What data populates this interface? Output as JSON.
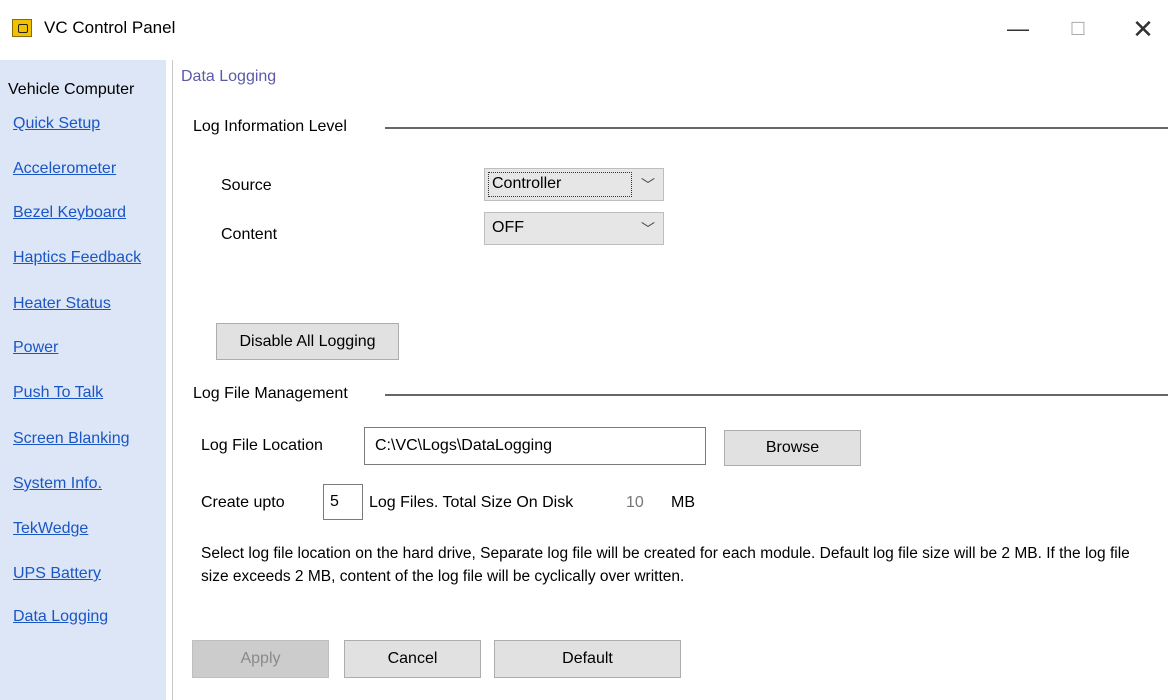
{
  "window": {
    "title": "VC Control Panel",
    "controls": {
      "minimize": "—",
      "maximize": "☐",
      "close": "✕"
    }
  },
  "sidebar": {
    "title": "Vehicle Computer",
    "items": [
      {
        "label": "Quick Setup"
      },
      {
        "label": "Accelerometer"
      },
      {
        "label": "Bezel Keyboard"
      },
      {
        "label": "Haptics Feedback"
      },
      {
        "label": "Heater Status"
      },
      {
        "label": "Power"
      },
      {
        "label": "Push To Talk"
      },
      {
        "label": "Screen Blanking"
      },
      {
        "label": "System Info."
      },
      {
        "label": "TekWedge"
      },
      {
        "label": "UPS Battery"
      },
      {
        "label": "Data Logging"
      }
    ]
  },
  "page": {
    "title": "Data Logging"
  },
  "log_info": {
    "group_label": "Log Information Level",
    "source_label": "Source",
    "source_value": "Controller",
    "content_label": "Content",
    "content_value": "OFF",
    "disable_button": "Disable All Logging"
  },
  "log_file": {
    "group_label": "Log File Management",
    "location_label": "Log File Location",
    "location_value": "C:\\VC\\Logs\\DataLogging",
    "browse_button": "Browse",
    "create_upto_label": "Create upto",
    "count_value": "5",
    "log_files_label": "Log Files.  Total Size On Disk",
    "total_size_value": "10",
    "size_unit": "MB",
    "note": "Select log file location on the hard drive, Separate log file will be created for each module. Default log file size will be 2 MB. If the log file size exceeds 2 MB, content of the log file will be cyclically over written."
  },
  "actions": {
    "apply": "Apply",
    "cancel": "Cancel",
    "default": "Default"
  },
  "colors": {
    "sidebar_bg": "#dce6f7",
    "link": "#1a56c4",
    "page_title": "#5a5aa8",
    "app_icon": "#f2c200"
  },
  "icons": [
    "app-icon",
    "minimize-icon",
    "maximize-icon",
    "close-icon",
    "chevron-down-icon"
  ]
}
